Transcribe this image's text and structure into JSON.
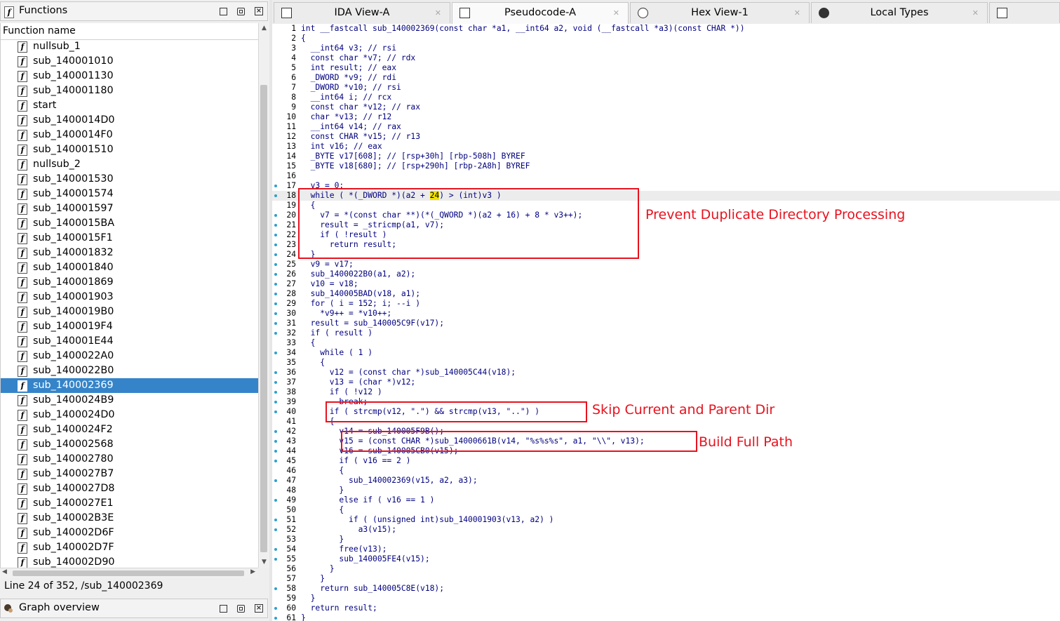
{
  "functions_panel": {
    "title": "Functions",
    "column_header": "Function name",
    "items": [
      "nullsub_1",
      "sub_140001010",
      "sub_140001130",
      "sub_140001180",
      "start",
      "sub_1400014D0",
      "sub_1400014F0",
      "sub_140001510",
      "nullsub_2",
      "sub_140001530",
      "sub_140001574",
      "sub_140001597",
      "sub_1400015BA",
      "sub_1400015F1",
      "sub_140001832",
      "sub_140001840",
      "sub_140001869",
      "sub_140001903",
      "sub_1400019B0",
      "sub_1400019F4",
      "sub_140001E44",
      "sub_1400022A0",
      "sub_1400022B0",
      "sub_140002369",
      "sub_1400024B9",
      "sub_1400024D0",
      "sub_1400024F2",
      "sub_140002568",
      "sub_140002780",
      "sub_1400027B7",
      "sub_1400027D8",
      "sub_1400027E1",
      "sub_140002B3E",
      "sub_140002D6F",
      "sub_140002D7F",
      "sub_140002D90"
    ],
    "selected": "sub_140002369",
    "status": "Line 24 of 352, /sub_140002369"
  },
  "graph_panel": {
    "title": "Graph overview"
  },
  "tabs": [
    {
      "label": "IDA View-A",
      "icon": "ida-view-icon"
    },
    {
      "label": "Pseudocode-A",
      "icon": "pseudocode-icon",
      "active": true
    },
    {
      "label": "Hex View-1",
      "icon": "hex-view-icon"
    },
    {
      "label": "Local Types",
      "icon": "local-types-icon"
    },
    {
      "label": "",
      "icon": "structures-icon"
    }
  ],
  "code_lines": [
    "int __fastcall sub_140002369(const char *a1, __int64 a2, void (__fastcall *a3)(const CHAR *))",
    "{",
    "  __int64 v3; // rsi",
    "  const char *v7; // rdx",
    "  int result; // eax",
    "  _DWORD *v9; // rdi",
    "  _DWORD *v10; // rsi",
    "  __int64 i; // rcx",
    "  const char *v12; // rax",
    "  char *v13; // r12",
    "  __int64 v14; // rax",
    "  const CHAR *v15; // r13",
    "  int v16; // eax",
    "  _BYTE v17[608]; // [rsp+30h] [rbp-508h] BYREF",
    "  _BYTE v18[680]; // [rsp+290h] [rbp-2A8h] BYREF",
    "",
    "  v3 = 0;",
    "  while ( *(_DWORD *)(a2 + 24) > (int)v3 )",
    "  {",
    "    v7 = *(const char **)(*(_QWORD *)(a2 + 16) + 8 * v3++);",
    "    result = _stricmp(a1, v7);",
    "    if ( !result )",
    "      return result;",
    "  }",
    "  v9 = v17;",
    "  sub_1400022B0(a1, a2);",
    "  v10 = v18;",
    "  sub_140005BAD(v18, a1);",
    "  for ( i = 152; i; --i )",
    "    *v9++ = *v10++;",
    "  result = sub_140005C9F(v17);",
    "  if ( result )",
    "  {",
    "    while ( 1 )",
    "    {",
    "      v12 = (const char *)sub_140005C44(v18);",
    "      v13 = (char *)v12;",
    "      if ( !v12 )",
    "        break;",
    "      if ( strcmp(v12, \".\") && strcmp(v13, \"..\") )",
    "      {",
    "        v14 = sub_140005F9B();",
    "        v15 = (const CHAR *)sub_14000661B(v14, \"%s%s%s\", a1, \"\\\\\", v13);",
    "        v16 = sub_140005CB0(v15);",
    "        if ( v16 == 2 )",
    "        {",
    "          sub_140002369(v15, a2, a3);",
    "        }",
    "        else if ( v16 == 1 )",
    "        {",
    "          if ( (unsigned int)sub_140001903(v13, a2) )",
    "            a3(v15);",
    "        }",
    "        free(v13);",
    "        sub_140005FE4(v15);",
    "      }",
    "    }",
    "    return sub_140005C8E(v18);",
    "  }",
    "  return result;",
    "}"
  ],
  "dotted_lines": [
    17,
    18,
    20,
    21,
    22,
    23,
    24,
    25,
    26,
    27,
    28,
    29,
    30,
    31,
    32,
    34,
    36,
    37,
    38,
    39,
    40,
    42,
    43,
    44,
    45,
    47,
    49,
    51,
    52,
    54,
    55,
    58,
    60,
    61
  ],
  "current_line": 18,
  "annotations": {
    "box1_label": "Prevent Duplicate Directory Processing",
    "box2_label": "Skip Current and Parent Dir",
    "box3_label": "Build Full Path"
  },
  "colors": {
    "annotation": "#e8121e",
    "selection": "#3584c9",
    "code": "#000080"
  }
}
